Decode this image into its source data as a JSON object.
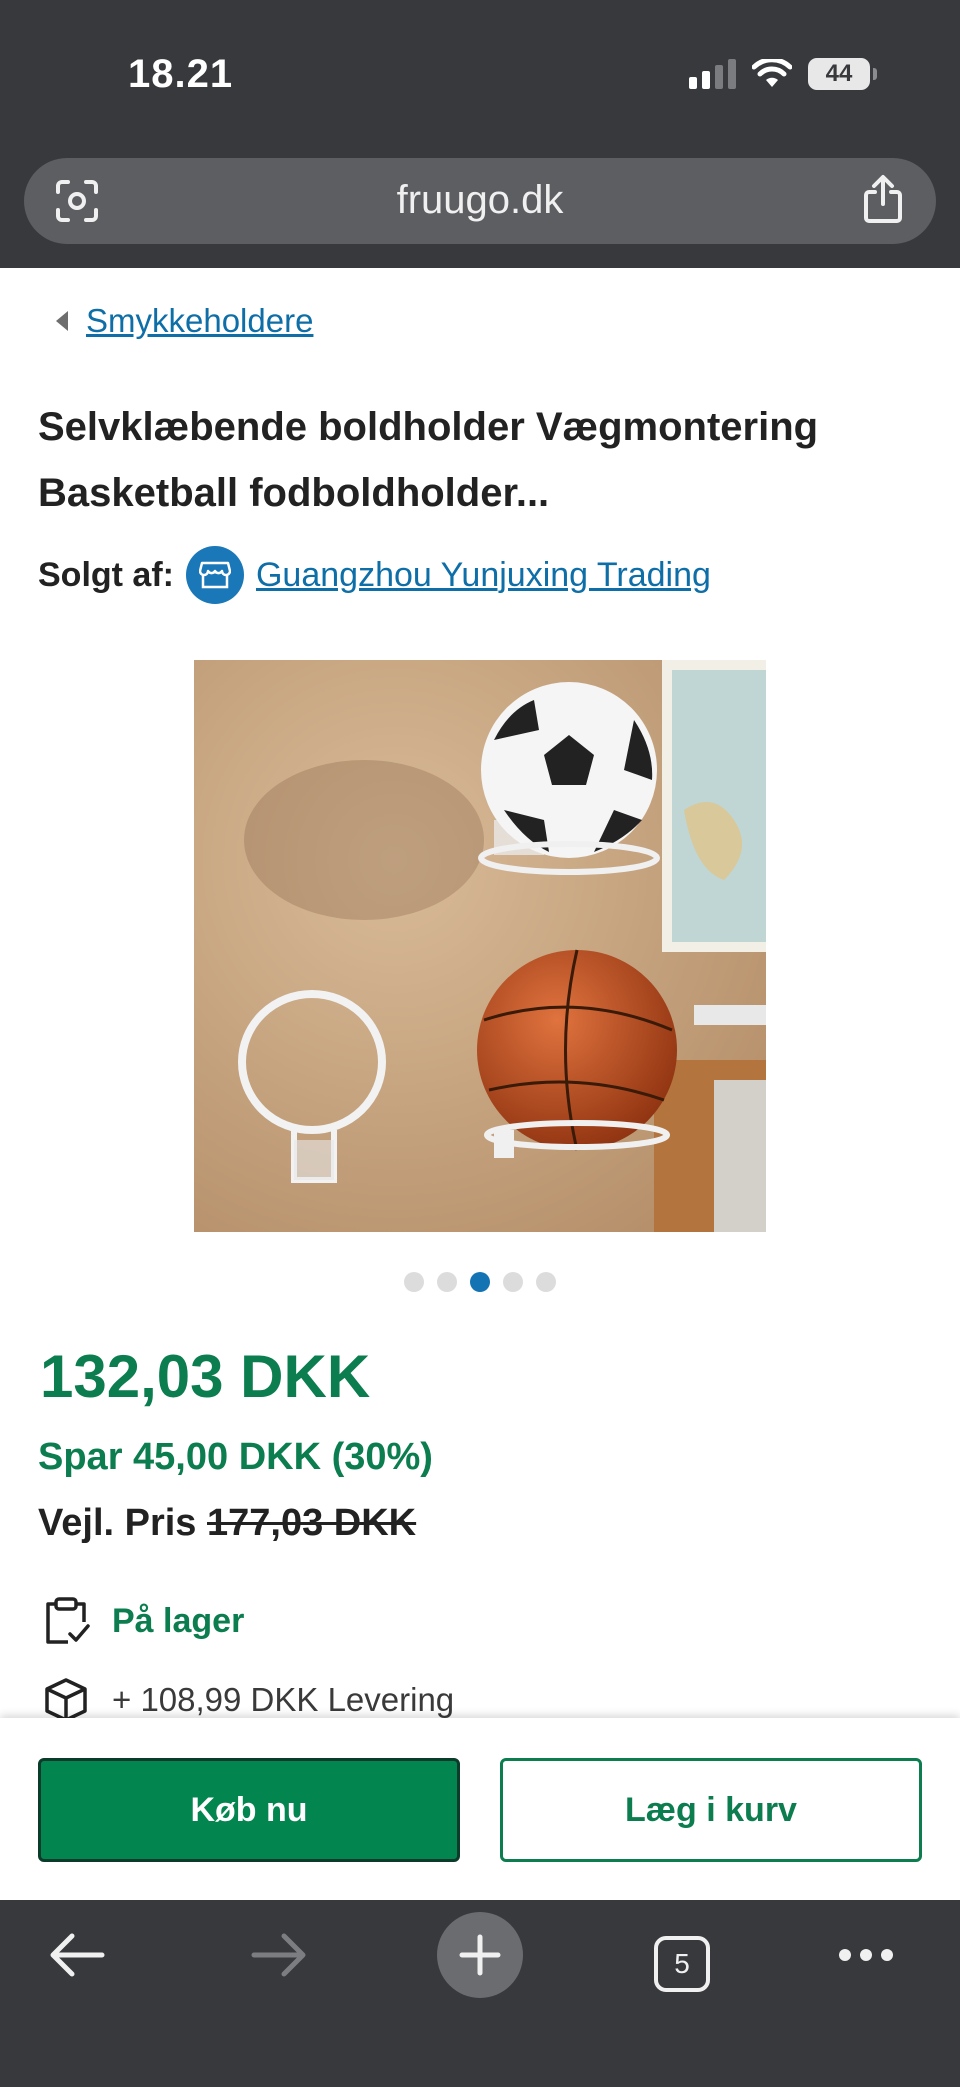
{
  "status_bar": {
    "time": "18.21",
    "battery": "44"
  },
  "browser": {
    "url": "fruugo.dk",
    "tab_count": "5"
  },
  "breadcrumb": {
    "label": "Smykkeholdere"
  },
  "product": {
    "title_line1": "Selvklæbende boldholder Vægmontering",
    "title_line2": "Basketball fodboldholder...",
    "seller_label": "Solgt af:",
    "seller_name": "Guangzhou Yunjuxing Trading",
    "image_count": 5,
    "active_image_index": 3,
    "price": "132,03 DKK",
    "saving": "Spar 45,00 DKK (30%)",
    "rrp_label": "Vejl. Pris",
    "rrp_value": "177,03 DKK",
    "stock_status": "På lager",
    "delivery": "+ 108,99 DKK Levering"
  },
  "actions": {
    "buy_now": "Køb nu",
    "add_to_cart": "Læg i kurv"
  },
  "colors": {
    "brand_green": "#0b7d4f",
    "link_blue": "#0e6ea7",
    "chrome_dark": "#37393d"
  },
  "icons": {
    "url_left": "camera-scan-icon",
    "url_right": "share-icon",
    "seller": "storefront-icon",
    "stock": "clipboard-check-icon",
    "delivery": "package-icon",
    "nav": [
      "back-arrow-icon",
      "forward-arrow-icon",
      "new-tab-plus-icon",
      "tabs-icon",
      "more-icon"
    ]
  }
}
